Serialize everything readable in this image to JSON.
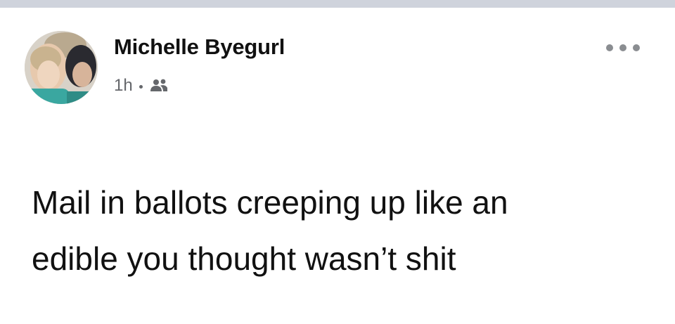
{
  "post": {
    "author_name": "Michelle Byegurl",
    "timestamp": "1h",
    "audience_icon": "friends-icon",
    "more_icon": "more-options-icon",
    "text": "Mail in ballots creeping up like an\nedible you thought wasn’t shit"
  },
  "colors": {
    "top_strip": "#cfd3dc",
    "text": "#111111",
    "meta": "#65676b",
    "more_dots": "#8a8d91"
  }
}
